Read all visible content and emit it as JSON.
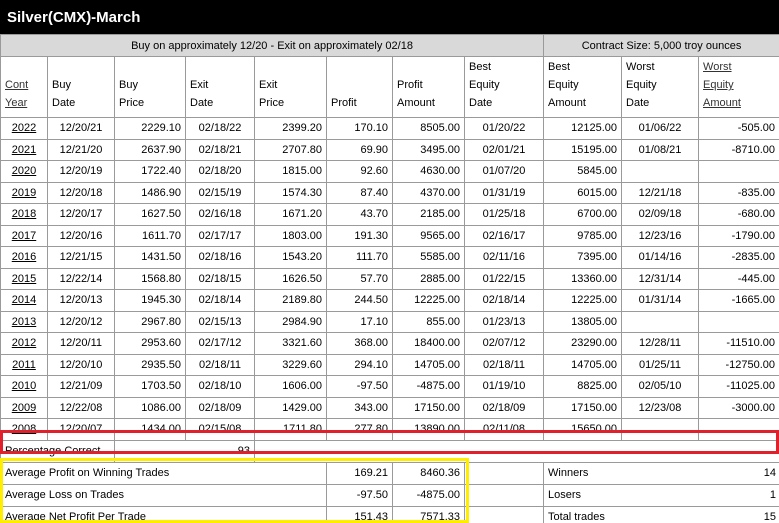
{
  "title": "Silver(CMX)-March",
  "banner": {
    "left": "Buy on approximately 12/20 - Exit on approximately 02/18",
    "right": "Contract Size: 5,000 troy ounces"
  },
  "headers": {
    "year": [
      "Cont",
      "Year"
    ],
    "buy_date": [
      "Buy",
      "Date"
    ],
    "buy_price": [
      "Buy",
      "Price"
    ],
    "exit_date": [
      "Exit",
      "Date"
    ],
    "exit_price": [
      "Exit",
      "Price"
    ],
    "profit": [
      "Profit"
    ],
    "profit_amount": [
      "Profit",
      "Amount"
    ],
    "best_equity_date": [
      "Best",
      "Equity",
      "Date"
    ],
    "best_equity_amount": [
      "Best",
      "Equity",
      "Amount"
    ],
    "worst_equity_date": [
      "Worst",
      "Equity",
      "Date"
    ],
    "worst_equity_amount": [
      "Worst",
      "Equity",
      "Amount"
    ]
  },
  "rows": [
    [
      "2022",
      "12/20/21",
      "2229.10",
      "02/18/22",
      "2399.20",
      "170.10",
      "8505.00",
      "01/20/22",
      "12125.00",
      "01/06/22",
      "-505.00"
    ],
    [
      "2021",
      "12/21/20",
      "2637.90",
      "02/18/21",
      "2707.80",
      "69.90",
      "3495.00",
      "02/01/21",
      "15195.00",
      "01/08/21",
      "-8710.00"
    ],
    [
      "2020",
      "12/20/19",
      "1722.40",
      "02/18/20",
      "1815.00",
      "92.60",
      "4630.00",
      "01/07/20",
      "5845.00",
      "",
      ""
    ],
    [
      "2019",
      "12/20/18",
      "1486.90",
      "02/15/19",
      "1574.30",
      "87.40",
      "4370.00",
      "01/31/19",
      "6015.00",
      "12/21/18",
      "-835.00"
    ],
    [
      "2018",
      "12/20/17",
      "1627.50",
      "02/16/18",
      "1671.20",
      "43.70",
      "2185.00",
      "01/25/18",
      "6700.00",
      "02/09/18",
      "-680.00"
    ],
    [
      "2017",
      "12/20/16",
      "1611.70",
      "02/17/17",
      "1803.00",
      "191.30",
      "9565.00",
      "02/16/17",
      "9785.00",
      "12/23/16",
      "-1790.00"
    ],
    [
      "2016",
      "12/21/15",
      "1431.50",
      "02/18/16",
      "1543.20",
      "111.70",
      "5585.00",
      "02/11/16",
      "7395.00",
      "01/14/16",
      "-2835.00"
    ],
    [
      "2015",
      "12/22/14",
      "1568.80",
      "02/18/15",
      "1626.50",
      "57.70",
      "2885.00",
      "01/22/15",
      "13360.00",
      "12/31/14",
      "-445.00"
    ],
    [
      "2014",
      "12/20/13",
      "1945.30",
      "02/18/14",
      "2189.80",
      "244.50",
      "12225.00",
      "02/18/14",
      "12225.00",
      "01/31/14",
      "-1665.00"
    ],
    [
      "2013",
      "12/20/12",
      "2967.80",
      "02/15/13",
      "2984.90",
      "17.10",
      "855.00",
      "01/23/13",
      "13805.00",
      "",
      ""
    ],
    [
      "2012",
      "12/20/11",
      "2953.60",
      "02/17/12",
      "3321.60",
      "368.00",
      "18400.00",
      "02/07/12",
      "23290.00",
      "12/28/11",
      "-11510.00"
    ],
    [
      "2011",
      "12/20/10",
      "2935.50",
      "02/18/11",
      "3229.60",
      "294.10",
      "14705.00",
      "02/18/11",
      "14705.00",
      "01/25/11",
      "-12750.00"
    ],
    [
      "2010",
      "12/21/09",
      "1703.50",
      "02/18/10",
      "1606.00",
      "-97.50",
      "-4875.00",
      "01/19/10",
      "8825.00",
      "02/05/10",
      "-11025.00"
    ],
    [
      "2009",
      "12/22/08",
      "1086.00",
      "02/18/09",
      "1429.00",
      "343.00",
      "17150.00",
      "02/18/09",
      "17150.00",
      "12/23/08",
      "-3000.00"
    ],
    [
      "2008",
      "12/20/07",
      "1434.00",
      "02/15/08",
      "1711.80",
      "277.80",
      "13890.00",
      "02/11/08",
      "15650.00",
      "",
      ""
    ]
  ],
  "summary": {
    "pct_correct_label": "Percentage Correct",
    "pct_correct_value": "93",
    "avg_win_label": "Average Profit on Winning Trades",
    "avg_win_profit": "169.21",
    "avg_win_amount": "8460.36",
    "avg_loss_label": "Average Loss on Trades",
    "avg_loss_profit": "-97.50",
    "avg_loss_amount": "-4875.00",
    "avg_net_label": "Average Net Profit Per Trade",
    "avg_net_profit": "151.43",
    "avg_net_amount": "7571.33",
    "winners_label": "Winners",
    "winners_value": "14",
    "losers_label": "Losers",
    "losers_value": "1",
    "total_label": "Total trades",
    "total_value": "15"
  },
  "highlight_colors": {
    "selected_row": "#e0202a",
    "summary_box": "#ffee00"
  }
}
